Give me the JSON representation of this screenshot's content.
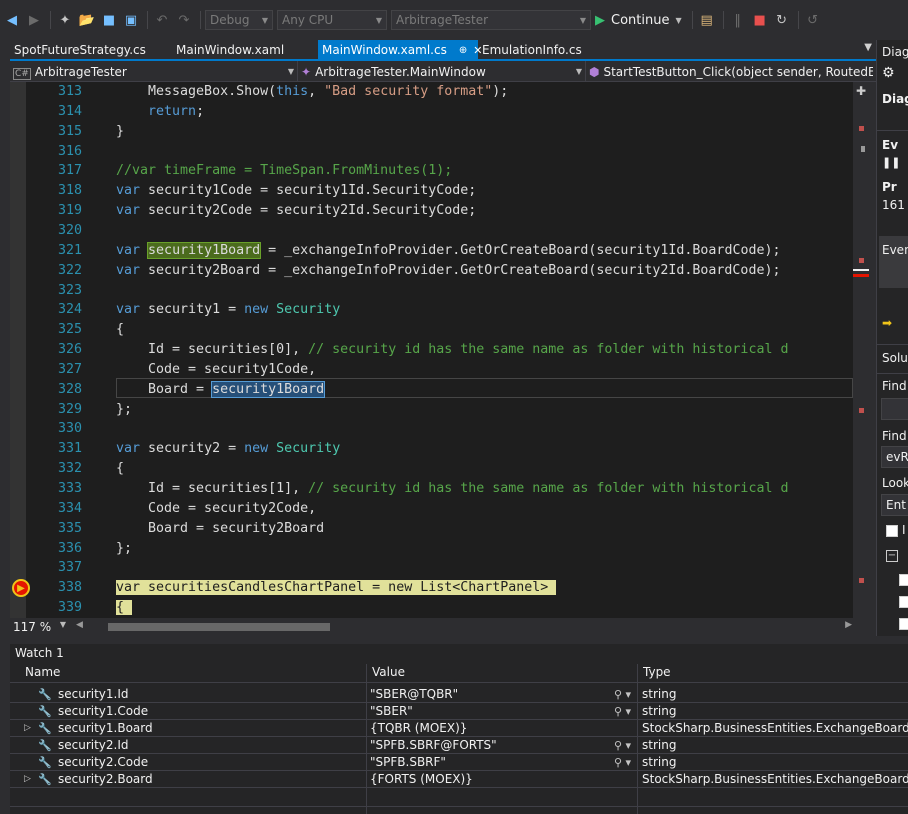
{
  "toolbar": {
    "config": "Debug",
    "platform": "Any CPU",
    "startup_project": "ArbitrageTester",
    "continue_label": "Continue"
  },
  "tabs": [
    {
      "label": "SpotFutureStrategy.cs",
      "active": false
    },
    {
      "label": "MainWindow.xaml",
      "active": false
    },
    {
      "label": "MainWindow.xaml.cs",
      "active": true
    },
    {
      "label": "EmulationInfo.cs",
      "active": false
    }
  ],
  "nav": {
    "project": "ArbitrageTester",
    "type": "ArbitrageTester.MainWindow",
    "member": "StartTestButton_Click(object sender, RoutedEve"
  },
  "code_lines": [
    {
      "n": "313",
      "html": "    MessageBox.Show(<span class=\"kw\">this</span>, <span class=\"str\">\"Bad security format\"</span>);"
    },
    {
      "n": "314",
      "html": "    <span class=\"kw\">return</span>;"
    },
    {
      "n": "315",
      "html": "}"
    },
    {
      "n": "316",
      "html": ""
    },
    {
      "n": "317",
      "html": "<span class=\"cm\">//var timeFrame = TimeSpan.FromMinutes(1);</span>"
    },
    {
      "n": "318",
      "html": "<span class=\"kw\">var</span> security1Code = security1Id.SecurityCode;"
    },
    {
      "n": "319",
      "html": "<span class=\"kw\">var</span> security2Code = security2Id.SecurityCode;"
    },
    {
      "n": "320",
      "html": ""
    },
    {
      "n": "321",
      "html": "<span class=\"kw\">var</span> <span class=\"hl-green\">security1Board</span> = _exchangeInfoProvider.GetOrCreateBoard(security1Id.BoardCode);"
    },
    {
      "n": "322",
      "html": "<span class=\"kw\">var</span> security2Board = _exchangeInfoProvider.GetOrCreateBoard(security2Id.BoardCode);"
    },
    {
      "n": "323",
      "html": ""
    },
    {
      "n": "324",
      "html": "<span class=\"kw\">var</span> security1 = <span class=\"kw\">new</span> <span class=\"tp\">Security</span>"
    },
    {
      "n": "325",
      "html": "{"
    },
    {
      "n": "326",
      "html": "    Id = securities[0], <span class=\"cm\">// security id has the same name as folder with historical d</span>"
    },
    {
      "n": "327",
      "html": "    Code = security1Code,"
    },
    {
      "n": "328",
      "html": "    Board = <span class=\"hl-blue\">security1Board</span>"
    },
    {
      "n": "329",
      "html": "};"
    },
    {
      "n": "330",
      "html": ""
    },
    {
      "n": "331",
      "html": "<span class=\"kw\">var</span> security2 = <span class=\"kw\">new</span> <span class=\"tp\">Security</span>"
    },
    {
      "n": "332",
      "html": "{"
    },
    {
      "n": "333",
      "html": "    Id = securities[1], <span class=\"cm\">// security id has the same name as folder with historical d</span>"
    },
    {
      "n": "334",
      "html": "    Code = security2Code,"
    },
    {
      "n": "335",
      "html": "    Board = security2Board"
    },
    {
      "n": "336",
      "html": "};"
    },
    {
      "n": "337",
      "html": ""
    },
    {
      "n": "338",
      "html": "<span class=\"current\">var securitiesCandlesChartPanel = new List&lt;ChartPanel&gt; </span>"
    },
    {
      "n": "339",
      "html": "<span class=\"current\">{ </span>"
    }
  ],
  "zoom": "117 %",
  "right_panel": {
    "title_partial": "Diagn",
    "diag_partial": "Diag",
    "ev_partial": "Ev",
    "pr_partial": "Pr",
    "num_partial": "161",
    "event_partial": "Even",
    "solution_partial": "Soluti",
    "find_partial": "Find",
    "find_label_partial": "Find",
    "find_value_partial": "evR",
    "look_partial": "Look",
    "look_value_partial": "Ent",
    "option_partial": "I"
  },
  "watch": {
    "title": "Watch 1",
    "columns": [
      "Name",
      "Value",
      "Type"
    ],
    "rows": [
      {
        "name": "security1.Id",
        "value": "\"SBER@TQBR\"",
        "type": "string",
        "expandable": false,
        "searchable": true
      },
      {
        "name": "security1.Code",
        "value": "\"SBER\"",
        "type": "string",
        "expandable": false,
        "searchable": true
      },
      {
        "name": "security1.Board",
        "value": "{TQBR (MOEX)}",
        "type": "StockSharp.BusinessEntities.ExchangeBoard",
        "expandable": true,
        "searchable": false
      },
      {
        "name": "security2.Id",
        "value": "\"SPFB.SBRF@FORTS\"",
        "type": "string",
        "expandable": false,
        "searchable": true
      },
      {
        "name": "security2.Code",
        "value": "\"SPFB.SBRF\"",
        "type": "string",
        "expandable": false,
        "searchable": true
      },
      {
        "name": "security2.Board",
        "value": "{FORTS (MOEX)}",
        "type": "StockSharp.BusinessEntities.ExchangeBoard",
        "expandable": true,
        "searchable": false
      }
    ]
  }
}
